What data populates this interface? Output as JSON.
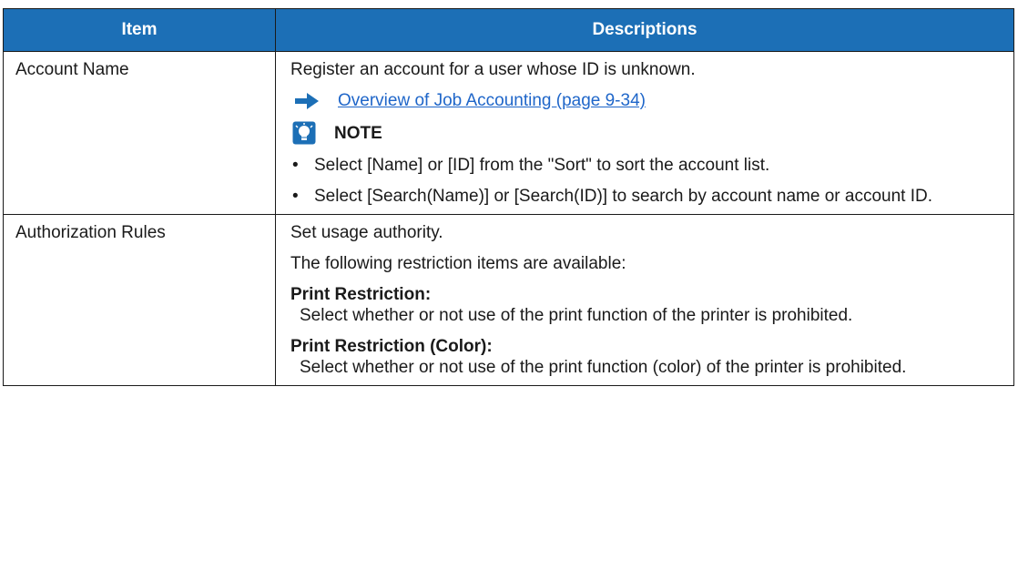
{
  "header": {
    "item": "Item",
    "descriptions": "Descriptions"
  },
  "rows": [
    {
      "item": "Account Name",
      "intro": "Register an account for a user whose ID is unknown.",
      "link": "Overview of Job Accounting (page 9-34)",
      "note_label": "NOTE",
      "bullets": [
        "Select [Name] or [ID] from the \"Sort\" to sort the account list.",
        "Select [Search(Name)] or [Search(ID)] to search by account name or account ID."
      ]
    },
    {
      "item": "Authorization Rules",
      "lines": [
        "Set usage authority.",
        "The following restriction items are available:"
      ],
      "terms": [
        {
          "name": "Print Restriction",
          "desc": "Select whether or not use of the print function of the printer is prohibited."
        },
        {
          "name": "Print Restriction (Color)",
          "desc": "Select whether or not use of the print function (color) of the printer is prohibited."
        }
      ]
    }
  ],
  "colors": {
    "header_bg": "#1c6fb6",
    "link": "#1f66c9",
    "arrow": "#1c6fb6"
  },
  "icons": {
    "link_arrow": "right-arrow-icon",
    "note": "lightbulb-note-icon"
  }
}
